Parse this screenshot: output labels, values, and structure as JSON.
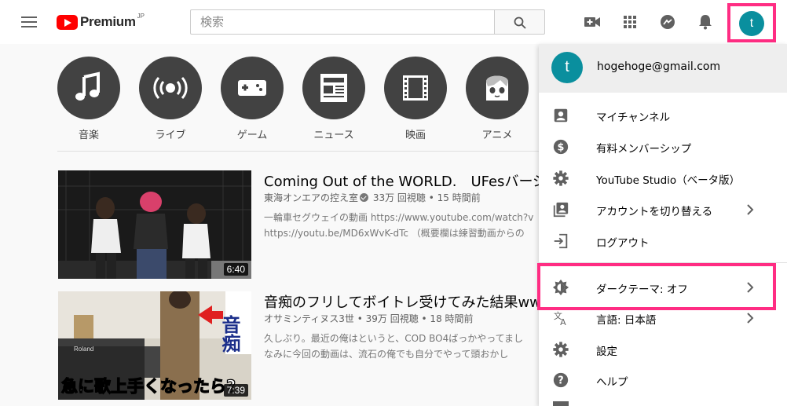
{
  "header": {
    "logo_text": "Premium",
    "logo_region": "JP",
    "search_placeholder": "検索",
    "avatar_letter": "t"
  },
  "categories": [
    {
      "label": "音楽",
      "icon": "music-note-icon"
    },
    {
      "label": "ライブ",
      "icon": "live-broadcast-icon"
    },
    {
      "label": "ゲーム",
      "icon": "gamepad-icon"
    },
    {
      "label": "ニュース",
      "icon": "newspaper-icon"
    },
    {
      "label": "映画",
      "icon": "film-icon"
    },
    {
      "label": "アニメ",
      "icon": "anime-face-icon"
    }
  ],
  "videos": [
    {
      "title": "Coming Out of the WORLD.　UFesバージョ",
      "channel": "東海オンエアの控え室",
      "verified": true,
      "stats": "33万 回視聴 • 15 時間前",
      "desc1": "一輪車セグウェイの動画 https://www.youtube.com/watch?v",
      "desc2": "https://youtu.be/MD6xWvK-dTc （概要欄は練習動画からの",
      "duration": "6:40"
    },
    {
      "title": "音痴のフリしてボイトレ受けてみた結果ww",
      "channel": "オサミンティヌス3世",
      "verified": false,
      "stats": "39万 回視聴 • 18 時間前",
      "desc1": "久しぶり。最近の俺はというと、COD BO4ばっかやってまし",
      "desc2": "なみに今回の動画は、流石の俺でも自分でやって頭おかし",
      "duration": "7:39",
      "thumb_caption": "急に歌上手くなったら?",
      "thumb_side_text": "音痴"
    }
  ],
  "account_menu": {
    "avatar_letter": "t",
    "email": "hogehoge@gmail.com",
    "items": [
      {
        "label": "マイチャンネル",
        "icon": "account-box-icon"
      },
      {
        "label": "有料メンバーシップ",
        "icon": "dollar-circle-icon"
      },
      {
        "label": "YouTube Studio（ベータ版）",
        "icon": "gear-icon"
      },
      {
        "label": "アカウントを切り替える",
        "icon": "switch-account-icon"
      },
      {
        "label": "ログアウト",
        "icon": "logout-icon"
      },
      {
        "label": "ダークテーマ: オフ",
        "icon": "dark-theme-icon"
      },
      {
        "label": "言語: 日本語",
        "icon": "translate-icon"
      },
      {
        "label": "設定",
        "icon": "gear-icon"
      },
      {
        "label": "ヘルプ",
        "icon": "help-icon"
      }
    ]
  },
  "colors": {
    "brand_red": "#ff0000",
    "highlight_pink": "#ff2d83",
    "avatar_teal": "#0a8f9e",
    "circle_gray": "#424242"
  }
}
